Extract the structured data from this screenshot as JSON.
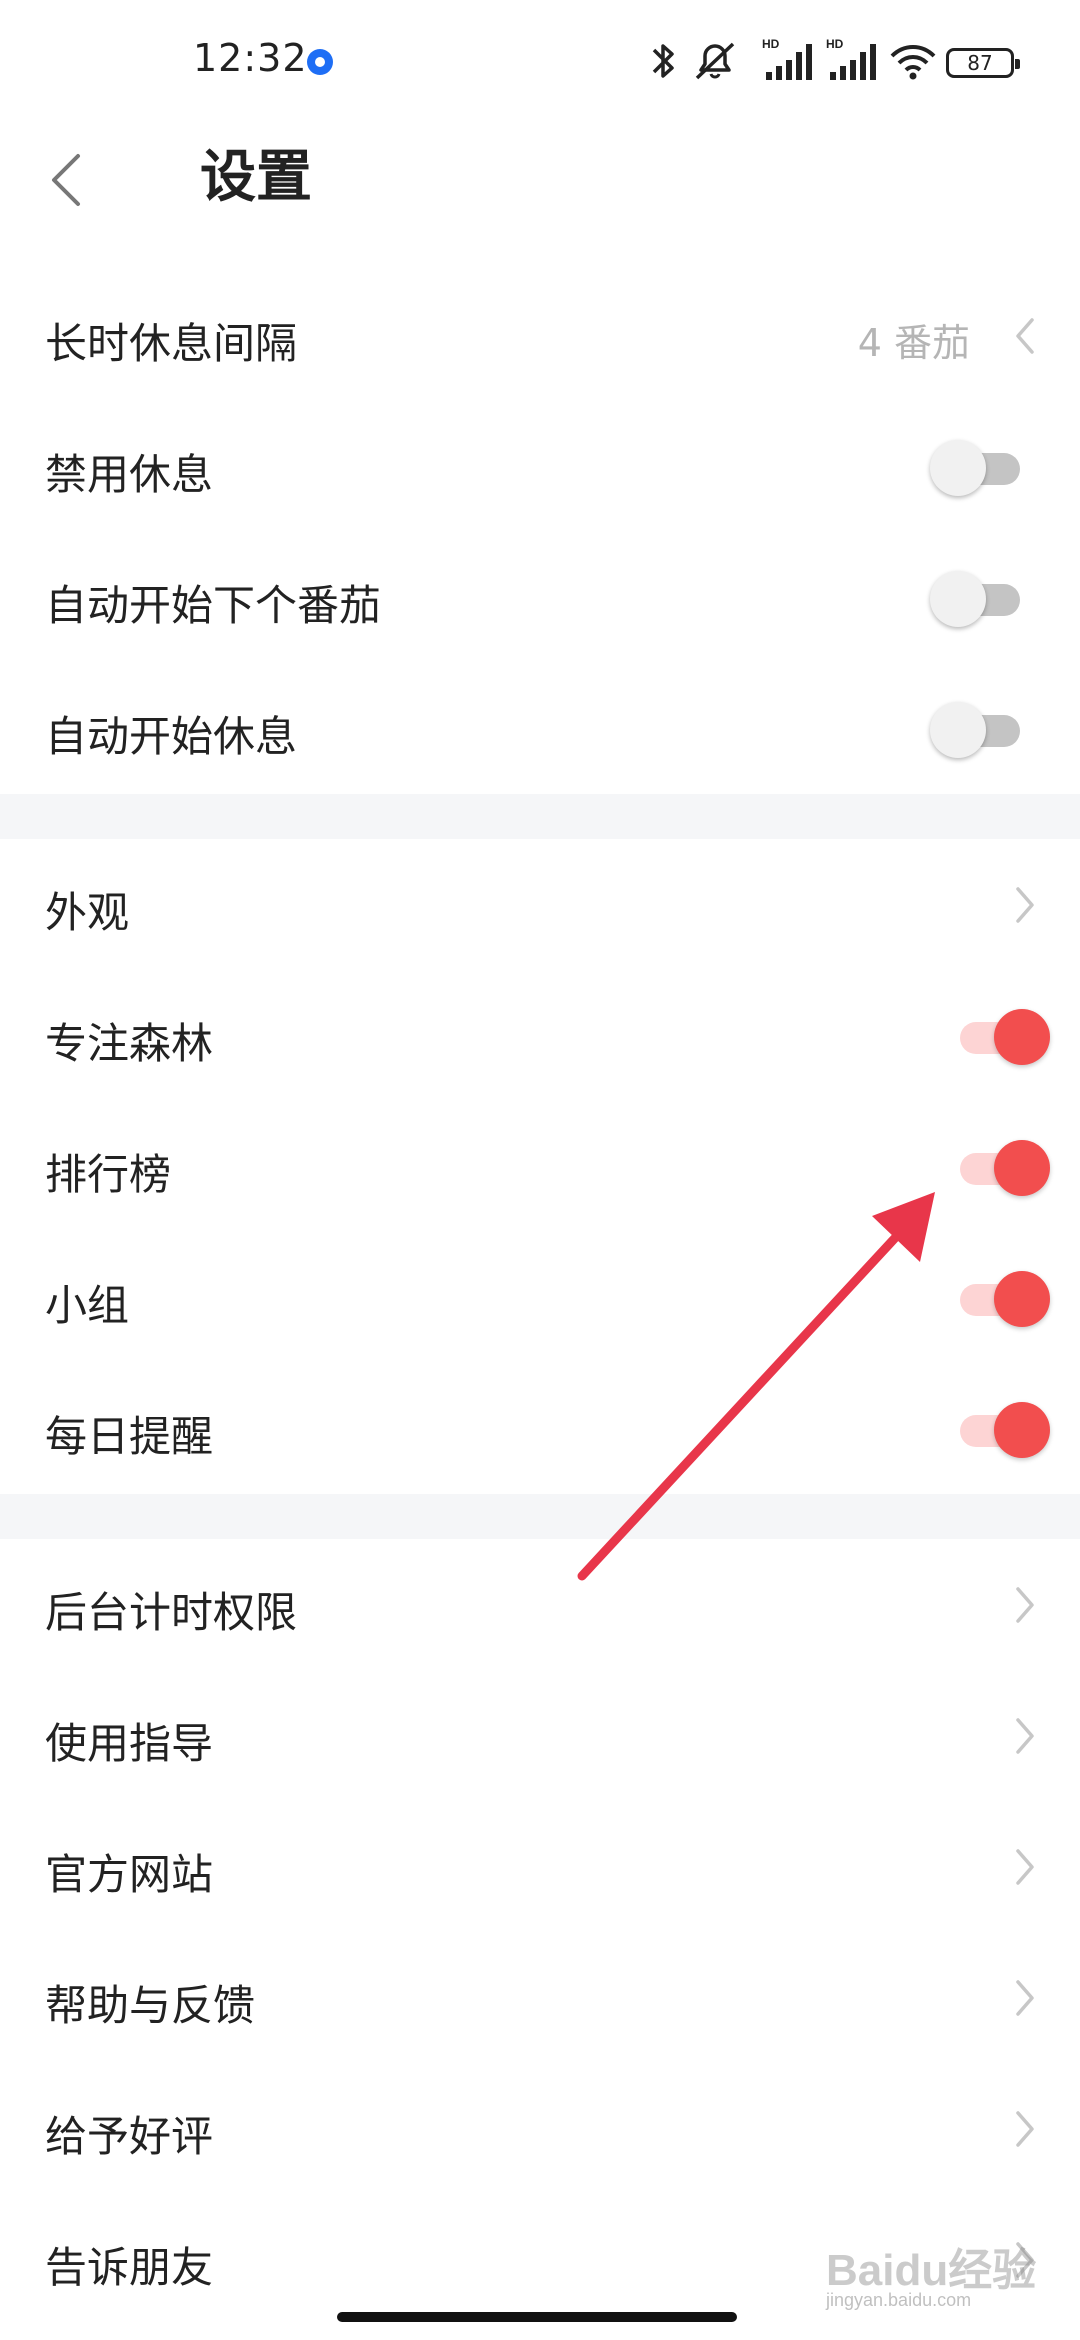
{
  "status_bar": {
    "time": "12:32",
    "battery": "87",
    "icons": [
      "bluetooth-icon",
      "mute-icon",
      "signal-hd-icon",
      "signal-hd-icon",
      "wifi-icon",
      "battery-icon"
    ]
  },
  "header": {
    "title": "设置",
    "back_icon": "chevron-left-icon"
  },
  "section1": [
    {
      "label": "长时休息间隔",
      "value": "4 番茄",
      "type": "select"
    },
    {
      "label": "禁用休息",
      "type": "toggle",
      "on": false
    },
    {
      "label": "自动开始下个番茄",
      "type": "toggle",
      "on": false
    },
    {
      "label": "自动开始休息",
      "type": "toggle",
      "on": false
    }
  ],
  "section2": [
    {
      "label": "外观",
      "type": "link"
    },
    {
      "label": "专注森林",
      "type": "toggle",
      "on": true
    },
    {
      "label": "排行榜",
      "type": "toggle",
      "on": true
    },
    {
      "label": "小组",
      "type": "toggle",
      "on": true
    },
    {
      "label": "每日提醒",
      "type": "toggle",
      "on": true
    }
  ],
  "section3": [
    {
      "label": "后台计时权限",
      "type": "link"
    },
    {
      "label": "使用指导",
      "type": "link"
    },
    {
      "label": "官方网站",
      "type": "link"
    },
    {
      "label": "帮助与反馈",
      "type": "link"
    },
    {
      "label": "给予好评",
      "type": "link"
    },
    {
      "label": "告诉朋友",
      "type": "link"
    }
  ],
  "colors": {
    "accent": "#f24e4e",
    "accent_track": "#fdd4d4",
    "annotation_arrow": "#e8364a",
    "section_gap": "#f5f6f8"
  },
  "watermark": {
    "logo": "Baidu经验",
    "sub": "jingyan.baidu.com"
  }
}
